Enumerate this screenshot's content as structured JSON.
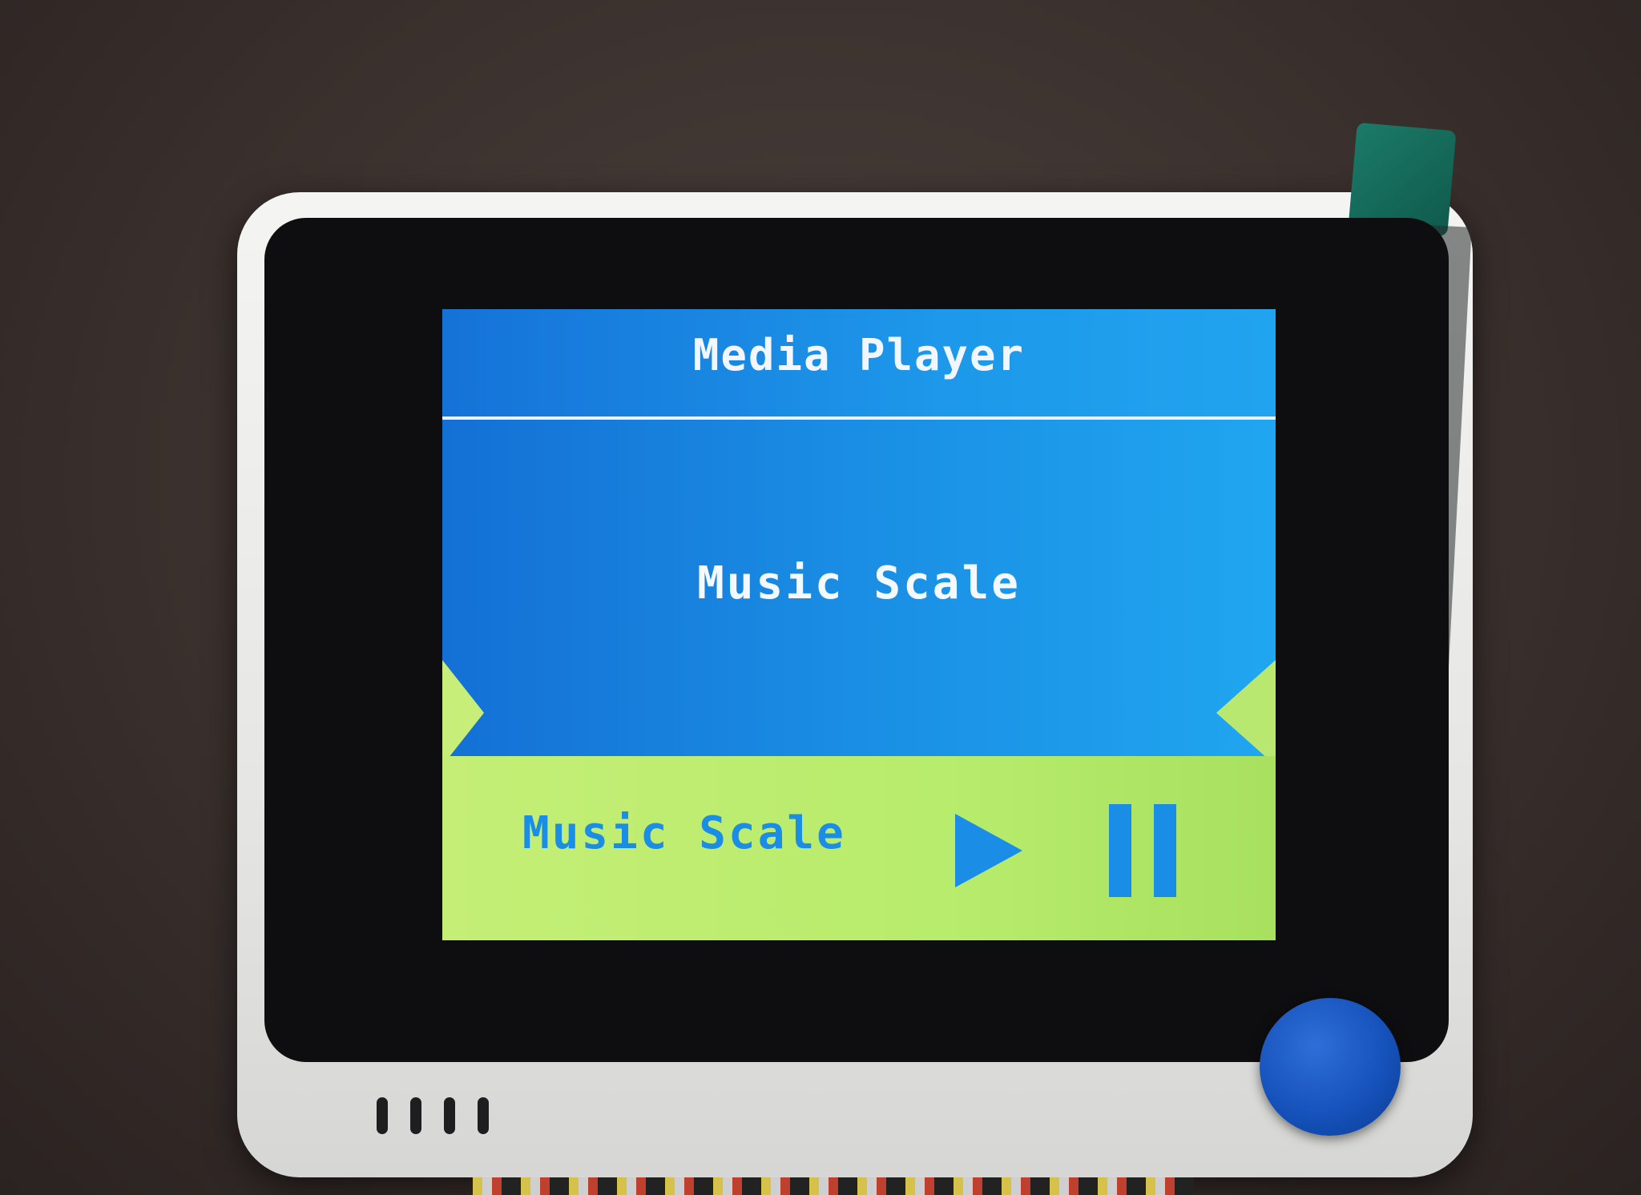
{
  "header": {
    "title": "Media Player"
  },
  "carousel": {
    "current_item": "Music Scale"
  },
  "now_playing": {
    "track_name": "Music Scale"
  },
  "colors": {
    "header_blue": "#1d98ea",
    "footer_green": "#b8ec6c",
    "accent_blue": "#1a8ee6",
    "arrow_green": "#c6ee78"
  },
  "icons": {
    "previous": "triangle-left-icon",
    "next": "triangle-right-icon",
    "play": "play-icon",
    "pause": "pause-icon"
  }
}
